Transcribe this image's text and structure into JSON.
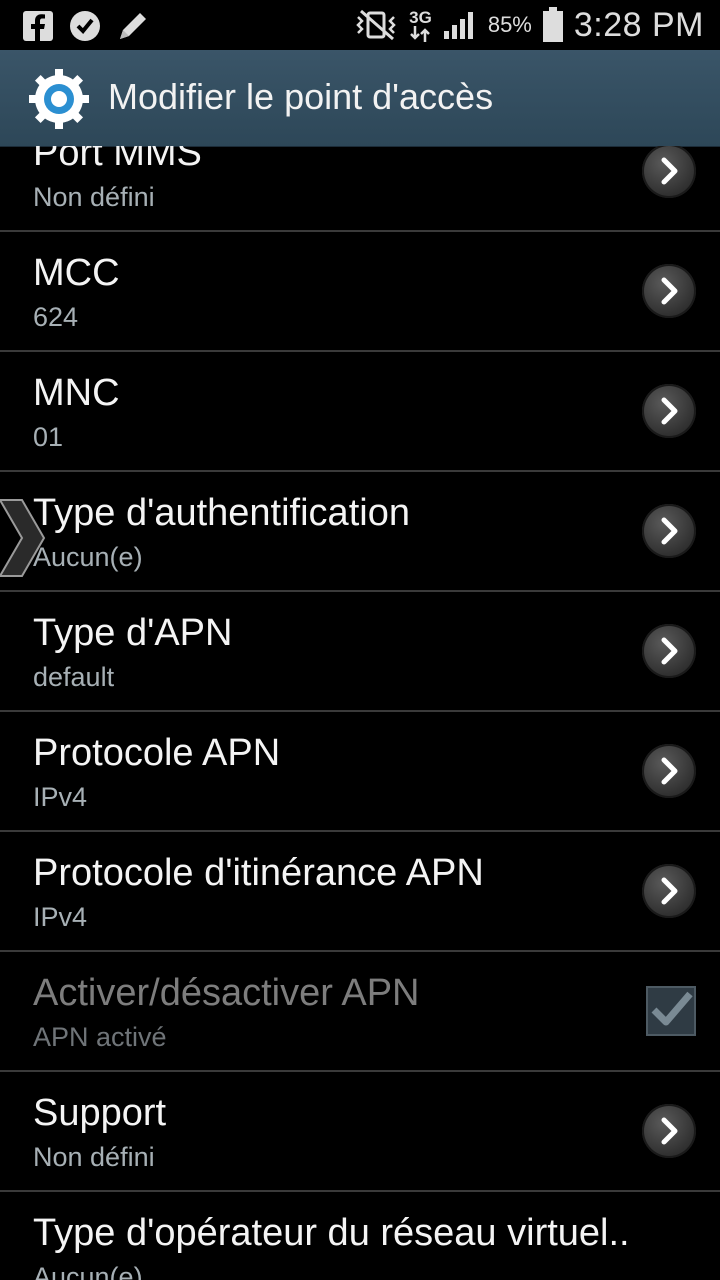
{
  "status_bar": {
    "icons_left": [
      "facebook-icon",
      "task-check-icon",
      "pencil-icon"
    ],
    "icons_right": [
      "mute-vibrate-icon",
      "network-3g-icon",
      "signal-icon"
    ],
    "network_label": "3G",
    "battery_percent": "85%",
    "time": "3:28 PM"
  },
  "header": {
    "title": "Modifier le point d'accès",
    "icon": "settings-gear-icon"
  },
  "settings": [
    {
      "title": "Port MMS",
      "value": "Non défini",
      "control": "chevron"
    },
    {
      "title": "MCC",
      "value": "624",
      "control": "chevron"
    },
    {
      "title": "MNC",
      "value": "01",
      "control": "chevron"
    },
    {
      "title": "Type d'authentification",
      "value": "Aucun(e)",
      "control": "chevron"
    },
    {
      "title": "Type d'APN",
      "value": "default",
      "control": "chevron"
    },
    {
      "title": "Protocole APN",
      "value": "IPv4",
      "control": "chevron"
    },
    {
      "title": "Protocole d'itinérance APN",
      "value": "IPv4",
      "control": "chevron"
    },
    {
      "title": "Activer/désactiver APN",
      "value": "APN activé",
      "control": "checkbox",
      "checked": true,
      "disabled": true
    },
    {
      "title": "Support",
      "value": "Non défini",
      "control": "chevron"
    },
    {
      "title": "Type d'opérateur du réseau virtuel..",
      "value": "Aucun(e)",
      "control": "chevron"
    }
  ],
  "colors": {
    "title_bar": "#34505f",
    "accent": "#33b5e5"
  }
}
